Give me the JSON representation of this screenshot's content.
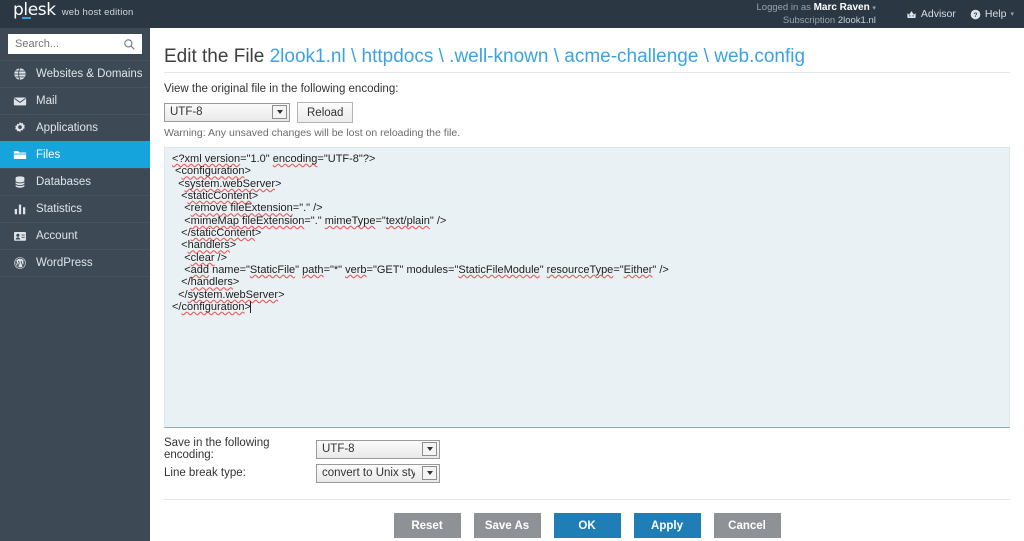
{
  "header": {
    "logo_main": "plesk",
    "logo_sub": "web host edition",
    "logged_in_label": "Logged in as",
    "user_name": "Marc Raven",
    "user_caret": "▾",
    "subscription_label": "Subscription",
    "subscription_value": "2look1.nl",
    "advisor_label": "Advisor",
    "help_label": "Help",
    "help_caret": "▾"
  },
  "sidebar": {
    "search_placeholder": "Search...",
    "items": [
      {
        "label": "Websites & Domains",
        "icon": "globe-icon",
        "active": false
      },
      {
        "label": "Mail",
        "icon": "envelope-icon",
        "active": false
      },
      {
        "label": "Applications",
        "icon": "gear-icon",
        "active": false
      },
      {
        "label": "Files",
        "icon": "folder-icon",
        "active": true
      },
      {
        "label": "Databases",
        "icon": "database-icon",
        "active": false
      },
      {
        "label": "Statistics",
        "icon": "bar-chart-icon",
        "active": false
      },
      {
        "label": "Account",
        "icon": "id-card-icon",
        "active": false
      },
      {
        "label": "WordPress",
        "icon": "wordpress-icon",
        "active": false
      }
    ]
  },
  "main": {
    "title_prefix": "Edit the File",
    "file_path": "2look1.nl \\ httpdocs \\ .well-known \\ acme-challenge \\ web.config",
    "view_encoding_label": "View the original file in the following encoding:",
    "view_encoding_value": "UTF-8",
    "reload_label": "Reload",
    "warning_text": "Warning: Any unsaved changes will be lost on reloading the file.",
    "file_content": "<?xml version=\"1.0\" encoding=\"UTF-8\"?>\n <configuration>\n  <system.webServer>\n   <staticContent>\n    <remove fileExtension=\".\" />\n    <mimeMap fileExtension=\".\" mimeType=\"text/plain\" />\n   </staticContent>\n   <handlers>\n    <clear />\n    <add name=\"StaticFile\" path=\"*\" verb=\"GET\" modules=\"StaticFileModule\" resourceType=\"Either\" />\n   </handlers>\n  </system.webServer>\n</configuration>",
    "save_encoding_label": "Save in the following encoding:",
    "save_encoding_value": "UTF-8",
    "line_break_label": "Line break type:",
    "line_break_value": "convert to Unix style",
    "buttons": [
      {
        "label": "Reset",
        "style": "gray"
      },
      {
        "label": "Save As",
        "style": "gray"
      },
      {
        "label": "OK",
        "style": "blue"
      },
      {
        "label": "Apply",
        "style": "blue"
      },
      {
        "label": "Cancel",
        "style": "gray"
      }
    ]
  },
  "colors": {
    "topbar": "#2b3844",
    "sidebar": "#3d4a55",
    "accent_active": "#16a4dd",
    "link_blue": "#3ca3e0",
    "button_blue": "#1f7eb6",
    "button_gray": "#8e9195",
    "code_bg": "#eaf1f5"
  }
}
